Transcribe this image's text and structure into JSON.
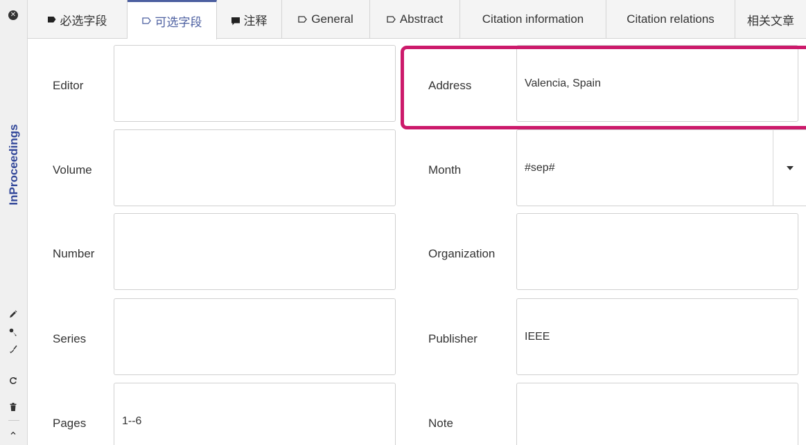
{
  "entry_type": "InProceedings",
  "tabs": [
    {
      "label": "必选字段",
      "icon": "tag-filled-icon"
    },
    {
      "label": "可选字段",
      "icon": "tag-outline-icon",
      "active": true
    },
    {
      "label": "注释",
      "icon": "comment-icon"
    },
    {
      "label": "General",
      "icon": "tag-outline-icon"
    },
    {
      "label": "Abstract",
      "icon": "tag-outline-icon"
    },
    {
      "label": "Citation information"
    },
    {
      "label": "Citation relations"
    },
    {
      "label": "相关文章"
    }
  ],
  "side_tools": [
    "pencil-icon",
    "key-icon",
    "broom-icon",
    "refresh-icon",
    "trash-icon",
    "chevron-up-icon"
  ],
  "left_fields": [
    {
      "label": "Editor",
      "value": ""
    },
    {
      "label": "Volume",
      "value": ""
    },
    {
      "label": "Number",
      "value": ""
    },
    {
      "label": "Series",
      "value": ""
    },
    {
      "label": "Pages",
      "value": "1--6"
    }
  ],
  "right_fields": [
    {
      "label": "Address",
      "value": "Valencia, Spain"
    },
    {
      "label": "Month",
      "value": "#sep#"
    },
    {
      "label": "Organization",
      "value": ""
    },
    {
      "label": "Publisher",
      "value": "IEEE"
    },
    {
      "label": "Note",
      "value": ""
    }
  ],
  "colors": {
    "accent": "#4c5fa0",
    "entry_type": "#33489a",
    "highlight": "#cc1a6b"
  }
}
